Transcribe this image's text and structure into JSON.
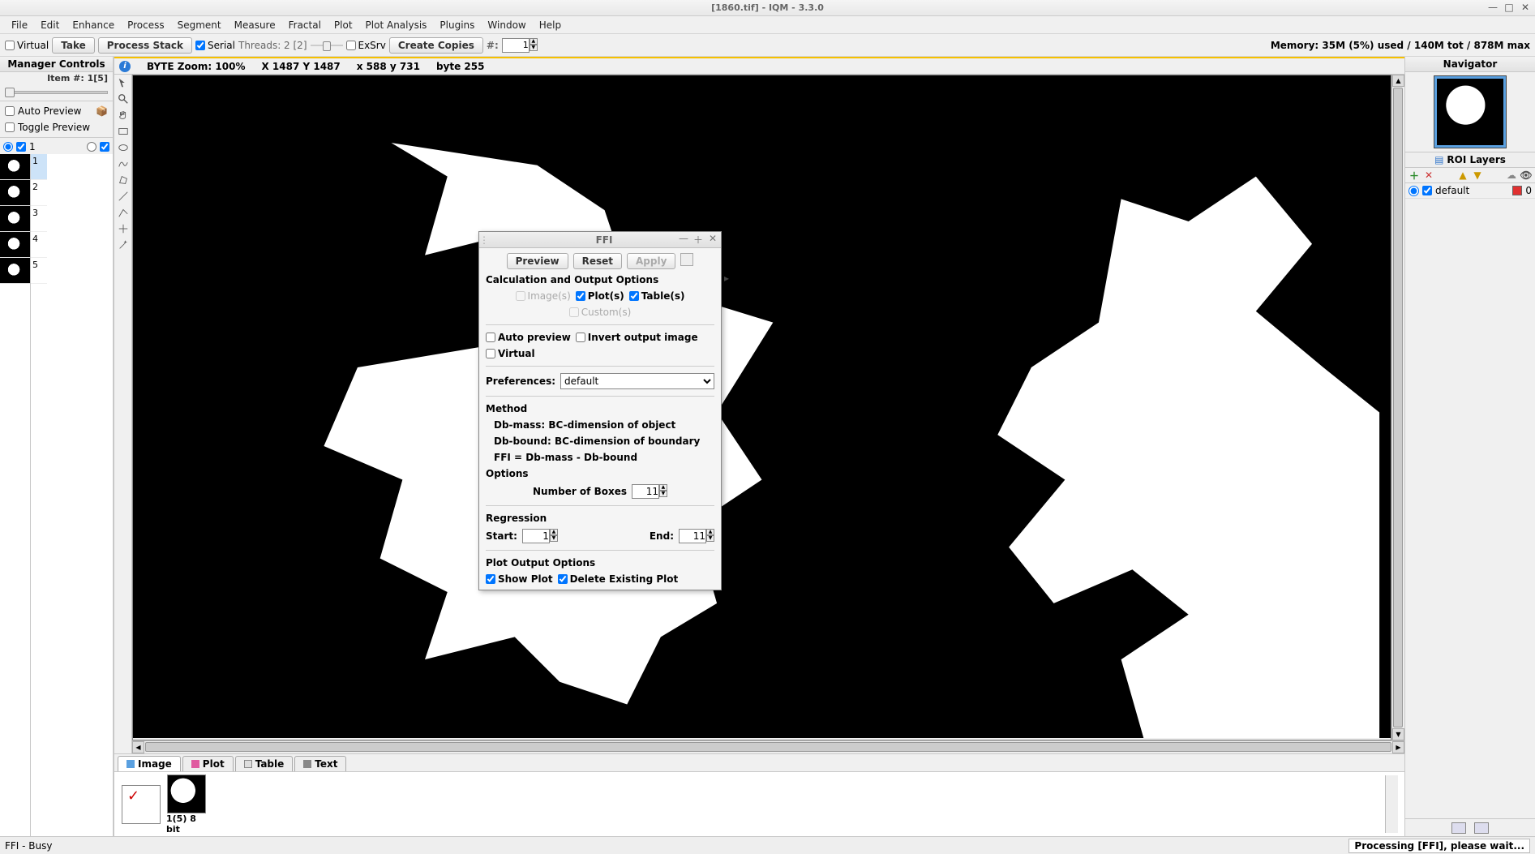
{
  "app": {
    "title": "[1860.tif] - IQM - 3.3.0"
  },
  "menu": [
    "File",
    "Edit",
    "Enhance",
    "Process",
    "Segment",
    "Measure",
    "Fractal",
    "Plot",
    "Plot Analysis",
    "Plugins",
    "Window",
    "Help"
  ],
  "toolbar": {
    "virtual_label": "Virtual",
    "take_label": "Take",
    "process_stack_label": "Process Stack",
    "serial_label": "Serial",
    "threads_label": "Threads: 2 [2]",
    "exsrv_label": "ExSrv",
    "create_copies_label": "Create Copies",
    "hash_label": "#:",
    "hash_value": "1",
    "memory_label": "Memory: 35M (5%) used / 140M tot / 878M max"
  },
  "manager": {
    "title": "Manager Controls",
    "item_label": "Item #: 1[5]",
    "auto_preview_label": "Auto Preview",
    "toggle_preview_label": "Toggle Preview",
    "count_value": "1",
    "thumbs": [
      "1",
      "2",
      "3",
      "4",
      "5"
    ]
  },
  "info_bar": {
    "zoom": "BYTE Zoom: 100%",
    "XY": "X 1487  Y 1487",
    "xy": "x 588  y 731",
    "byte": "byte 255"
  },
  "under_tabs": {
    "image": "Image",
    "plot": "Plot",
    "table": "Table",
    "text": "Text"
  },
  "strip": {
    "caption": "1(5) 8 bit"
  },
  "nav": {
    "title": "Navigator",
    "roi_title": "ROI Layers",
    "default_name": "default",
    "default_count": "0",
    "default_color": "#e03030"
  },
  "status": {
    "left": "FFI - Busy",
    "right": "Processing [FFI], please wait..."
  },
  "ffi": {
    "title": "FFI",
    "preview": "Preview",
    "reset": "Reset",
    "apply": "Apply",
    "calc_title": "Calculation and Output Options",
    "images": "Image(s)",
    "plots": "Plot(s)",
    "tables": "Table(s)",
    "customs": "Custom(s)",
    "auto_preview": "Auto preview",
    "invert": "Invert output image",
    "virtual": "Virtual",
    "prefs_label": "Preferences:",
    "prefs_value": "default",
    "method_title": "Method",
    "method_l1": "Db-mass:    BC-dimension of object",
    "method_l2": "Db-bound: BC-dimension of boundary",
    "method_l3": "FFI = Db-mass - Db-bound",
    "options_title": "Options",
    "num_boxes_label": "Number of Boxes",
    "num_boxes_value": "11",
    "regression_title": "Regression",
    "start_label": "Start:",
    "start_value": "1",
    "end_label": "End:",
    "end_value": "11",
    "plot_out_title": "Plot Output Options",
    "show_plot": "Show Plot",
    "delete_existing": "Delete Existing Plot"
  }
}
